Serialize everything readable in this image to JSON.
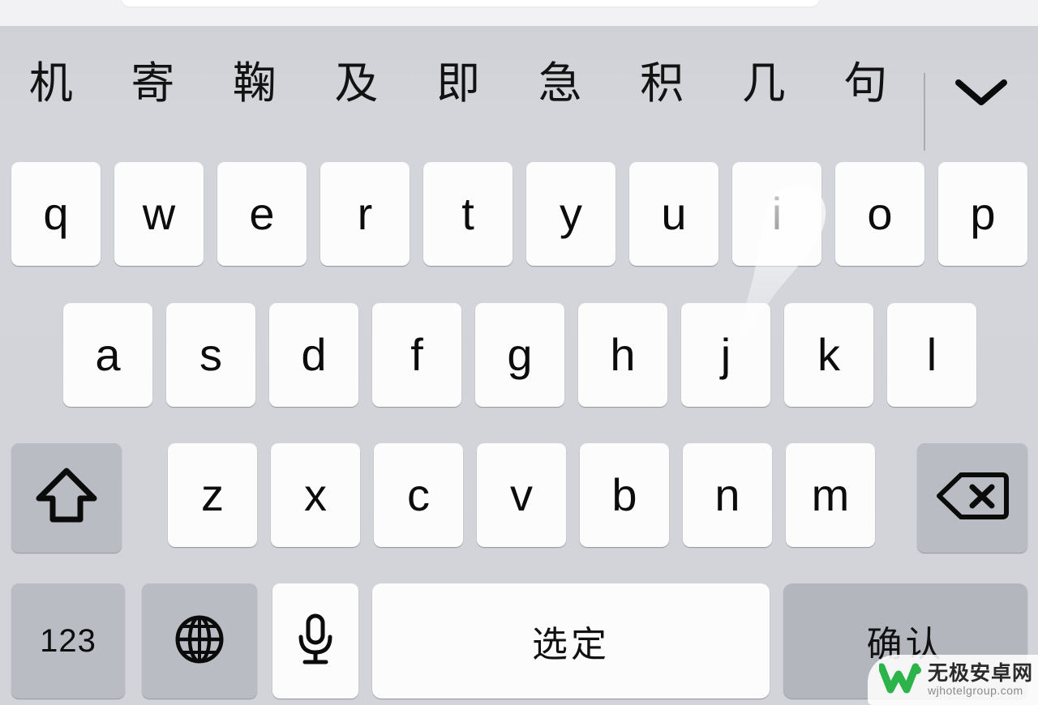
{
  "app": {
    "text_field_placeholder": ""
  },
  "keyboard": {
    "language": "Chinese Pinyin",
    "background_color": "#d2d4d9",
    "key_color": "#fcfcfd",
    "special_key_color": "#b9bcc3",
    "candidate_bar": {
      "candidates": [
        "机",
        "寄",
        "鞠",
        "及",
        "即",
        "急",
        "积",
        "几",
        "句"
      ],
      "expand_icon": "chevron-down-icon"
    },
    "rows": [
      {
        "name": "row-1",
        "keys": [
          {
            "label": "q",
            "type": "letter"
          },
          {
            "label": "w",
            "type": "letter"
          },
          {
            "label": "e",
            "type": "letter"
          },
          {
            "label": "r",
            "type": "letter"
          },
          {
            "label": "t",
            "type": "letter"
          },
          {
            "label": "y",
            "type": "letter"
          },
          {
            "label": "u",
            "type": "letter"
          },
          {
            "label": "i",
            "type": "letter"
          },
          {
            "label": "o",
            "type": "letter"
          },
          {
            "label": "p",
            "type": "letter"
          }
        ]
      },
      {
        "name": "row-2",
        "keys": [
          {
            "label": "a",
            "type": "letter"
          },
          {
            "label": "s",
            "type": "letter"
          },
          {
            "label": "d",
            "type": "letter"
          },
          {
            "label": "f",
            "type": "letter"
          },
          {
            "label": "g",
            "type": "letter"
          },
          {
            "label": "h",
            "type": "letter"
          },
          {
            "label": "j",
            "type": "letter"
          },
          {
            "label": "k",
            "type": "letter"
          },
          {
            "label": "l",
            "type": "letter"
          }
        ]
      },
      {
        "name": "row-3",
        "keys": [
          {
            "label": "",
            "type": "shift",
            "icon": "shift-arrow-icon"
          },
          {
            "label": "z",
            "type": "letter"
          },
          {
            "label": "x",
            "type": "letter"
          },
          {
            "label": "c",
            "type": "letter"
          },
          {
            "label": "v",
            "type": "letter"
          },
          {
            "label": "b",
            "type": "letter"
          },
          {
            "label": "n",
            "type": "letter"
          },
          {
            "label": "m",
            "type": "letter"
          },
          {
            "label": "",
            "type": "backspace",
            "icon": "backspace-icon"
          }
        ]
      },
      {
        "name": "row-4",
        "keys": [
          {
            "label": "123",
            "type": "numeric"
          },
          {
            "label": "",
            "type": "globe",
            "icon": "globe-icon"
          },
          {
            "label": "",
            "type": "dictation",
            "icon": "microphone-icon"
          },
          {
            "label": "选定",
            "type": "space"
          },
          {
            "label": "确认",
            "type": "enter"
          }
        ]
      }
    ]
  },
  "watermark": {
    "logo": "w-logo-icon",
    "title": "无极安卓网",
    "url": "wjhotelgroup.com",
    "brand_color": "#2cb34a"
  }
}
